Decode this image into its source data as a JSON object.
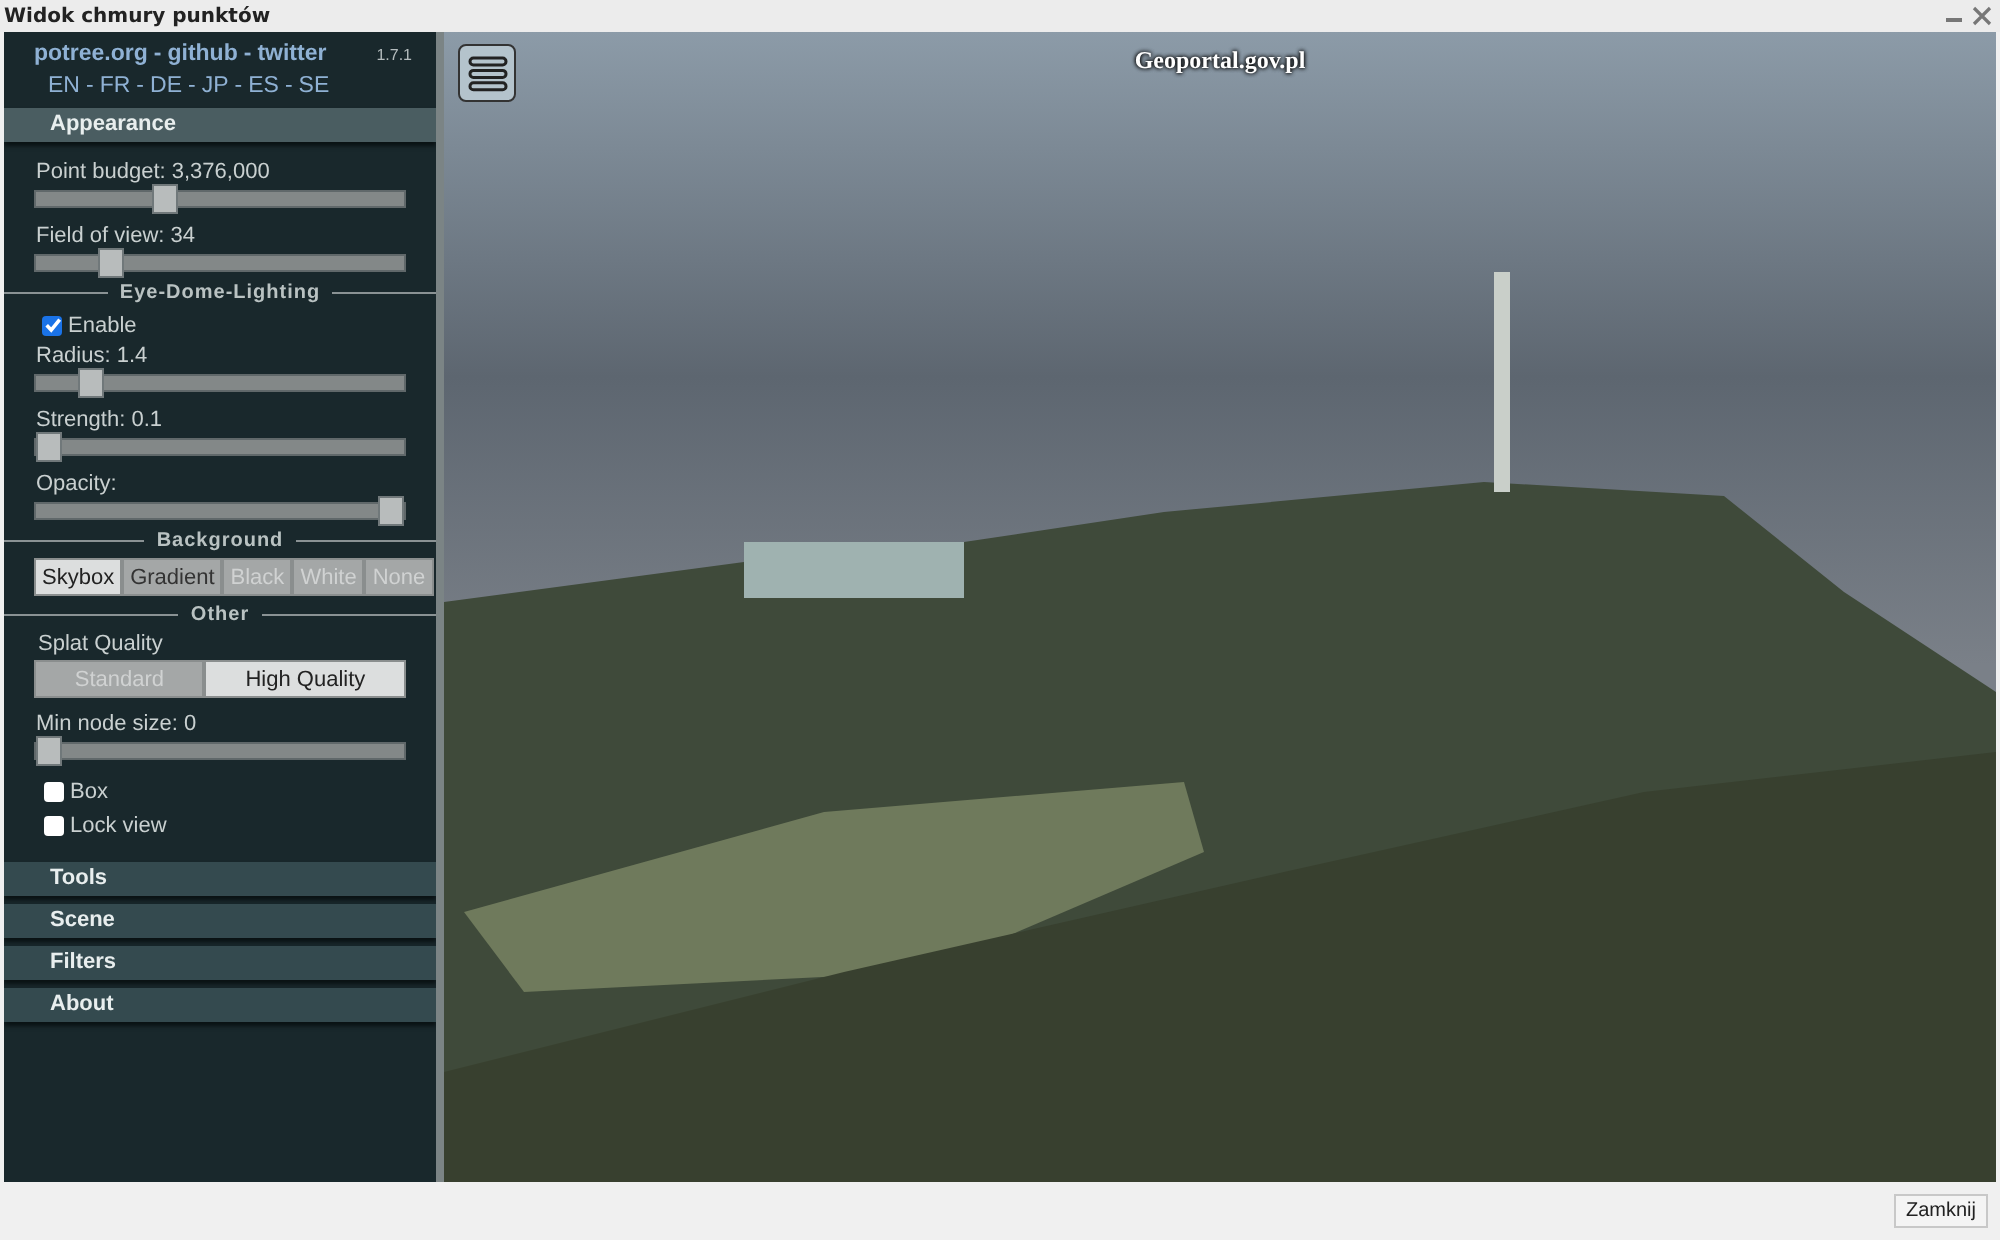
{
  "window": {
    "title": "Widok chmury punktów"
  },
  "sidebar": {
    "links": [
      {
        "label": "potree.org"
      },
      {
        "label": "github"
      },
      {
        "label": "twitter"
      }
    ],
    "separator": "-",
    "version": "1.7.1",
    "languages": [
      "EN",
      "FR",
      "DE",
      "JP",
      "ES",
      "SE"
    ],
    "sections": [
      {
        "title": "Appearance",
        "expanded": true,
        "controls": [
          {
            "kind": "slider",
            "label": "Point budget: 3,376,000",
            "level": 0.34
          },
          {
            "kind": "slider",
            "label": "Field of view: 34",
            "level": 0.18
          },
          {
            "kind": "heading",
            "label": "Eye-Dome-Lighting"
          },
          {
            "kind": "checkbox",
            "label": "Enable",
            "checked": true
          },
          {
            "kind": "slider",
            "label": "Radius: 1.4",
            "level": 0.12
          },
          {
            "kind": "slider",
            "label": "Strength: 0.1",
            "level": 0.0
          },
          {
            "kind": "slider",
            "label": "Opacity:",
            "level": 1.0
          },
          {
            "kind": "heading",
            "label": "Background"
          },
          {
            "kind": "segmented",
            "options": [
              {
                "label": "Skybox",
                "selected": true,
                "disabled": false
              },
              {
                "label": "Gradient",
                "selected": false,
                "disabled": false
              },
              {
                "label": "Black",
                "selected": false,
                "disabled": true
              },
              {
                "label": "White",
                "selected": false,
                "disabled": true
              },
              {
                "label": "None",
                "selected": false,
                "disabled": true
              }
            ]
          },
          {
            "kind": "heading",
            "label": "Other"
          },
          {
            "kind": "label",
            "label": "Splat Quality"
          },
          {
            "kind": "segmented",
            "options": [
              {
                "label": "Standard",
                "selected": false,
                "disabled": true
              },
              {
                "label": "High Quality",
                "selected": true,
                "disabled": false
              }
            ]
          },
          {
            "kind": "slider",
            "label": "Min node size: 0",
            "level": 0.0
          },
          {
            "kind": "checkbox",
            "label": "Box",
            "checked": false
          },
          {
            "kind": "checkbox",
            "label": "Lock view",
            "checked": false
          }
        ]
      },
      {
        "title": "Tools",
        "expanded": false
      },
      {
        "title": "Scene",
        "expanded": false
      },
      {
        "title": "Filters",
        "expanded": false
      },
      {
        "title": "About",
        "expanded": false
      }
    ]
  },
  "viewer": {
    "attribution": "Geoportal.gov.pl"
  },
  "footer": {
    "button": "Zamknij"
  }
}
